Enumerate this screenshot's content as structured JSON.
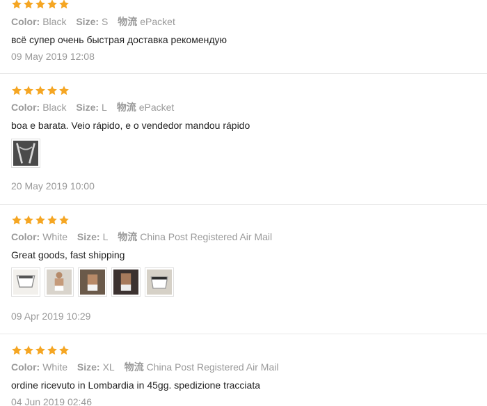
{
  "colors": {
    "star": "#f5a623",
    "muted": "#999999",
    "text": "#222222",
    "divider": "#e8e8e8"
  },
  "reviews": [
    {
      "stars": 5,
      "attrs": [
        {
          "key": "Color:",
          "value": "Black"
        },
        {
          "key": "Size:",
          "value": "S"
        },
        {
          "key": "物流",
          "value": "ePacket"
        }
      ],
      "text": "всё супер очень быстрая доставка рекомендую",
      "photos": [],
      "date": "09 May 2019 12:08"
    },
    {
      "stars": 5,
      "attrs": [
        {
          "key": "Color:",
          "value": "Black"
        },
        {
          "key": "Size:",
          "value": "L"
        },
        {
          "key": "物流",
          "value": "ePacket"
        }
      ],
      "text": "boa e barata. Veio rápido, e o vendedor mandou rápido",
      "photos": [
        "review-photo-1"
      ],
      "date": "20 May 2019 10:00"
    },
    {
      "stars": 5,
      "attrs": [
        {
          "key": "Color:",
          "value": "White"
        },
        {
          "key": "Size:",
          "value": "L"
        },
        {
          "key": "物流",
          "value": "China Post Registered Air Mail"
        }
      ],
      "text": "Great goods, fast shipping",
      "photos": [
        "review-photo-1",
        "review-photo-2",
        "review-photo-3",
        "review-photo-4",
        "review-photo-5"
      ],
      "date": "09 Apr 2019 10:29"
    },
    {
      "stars": 5,
      "attrs": [
        {
          "key": "Color:",
          "value": "White"
        },
        {
          "key": "Size:",
          "value": "XL"
        },
        {
          "key": "物流",
          "value": "China Post Registered Air Mail"
        }
      ],
      "text": "ordine ricevuto in Lombardia in 45gg. spedizione tracciata",
      "photos": [],
      "date": "04 Jun 2019 02:46"
    }
  ]
}
